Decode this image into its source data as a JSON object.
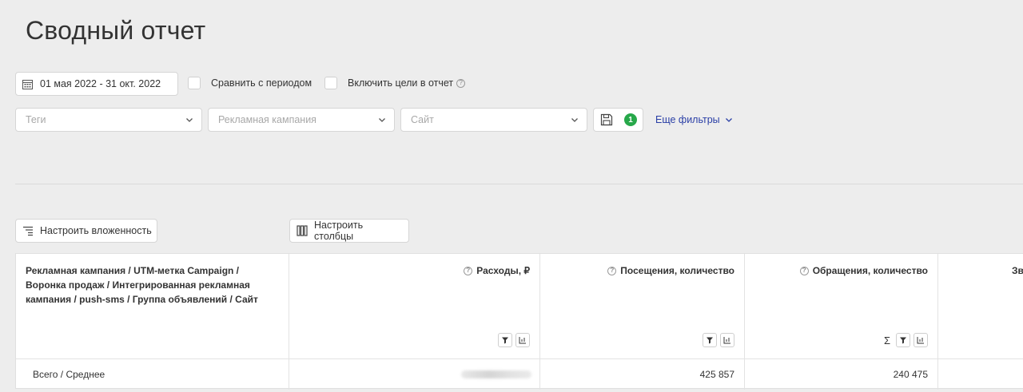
{
  "page": {
    "title": "Сводный отчет"
  },
  "filters": {
    "date_range": "01 мая 2022 - 31 окт. 2022",
    "compare_label": "Сравнить с периодом",
    "include_goals_label": "Включить цели в отчет",
    "tags_placeholder": "Теги",
    "campaign_placeholder": "Рекламная кампания",
    "site_placeholder": "Сайт",
    "saved_count": "1",
    "more_filters_label": "Еще фильтры"
  },
  "toolbar": {
    "nesting_label": "Настроить вложенность",
    "columns_label": "Настроить столбцы"
  },
  "table": {
    "first_header": "Рекламная кампания / UTM-метка Campaign / Воронка продаж / Интегрированная рекламная кампания / push-sms / Группа объявлений / Сайт",
    "columns": [
      {
        "label": "Расходы, ₽"
      },
      {
        "label": "Посещения, количество"
      },
      {
        "label": "Обращения, количество"
      },
      {
        "label": "Зво"
      }
    ],
    "total_row": {
      "label": "Всего / Среднее",
      "values": [
        "",
        "425 857",
        "240 475"
      ]
    }
  },
  "colors": {
    "accent": "#2a3fa6",
    "badge": "#27a84a",
    "background": "#ededed"
  }
}
